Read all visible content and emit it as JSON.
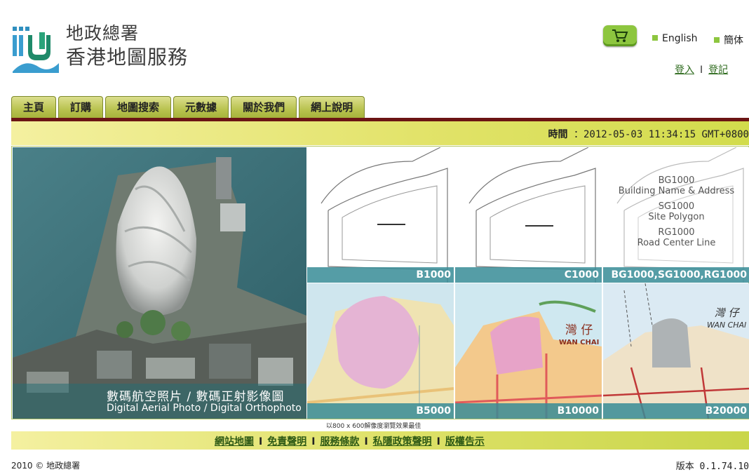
{
  "header": {
    "org_line1": "地政總署",
    "org_line2": "香港地圖服務",
    "lang_english": "English",
    "lang_simplified": "簡体",
    "login": "登入",
    "auth_separator": "I",
    "register": "登記"
  },
  "nav": {
    "tabs": [
      "主頁",
      "訂購",
      "地圖搜索",
      "元數據",
      "關於我們",
      "網上說明"
    ]
  },
  "timebar": {
    "label": "時間",
    "value": "：2012-05-03 11:34:15 GMT+0800"
  },
  "gallery": {
    "main": {
      "caption_zh": "數碼航空照片 / 數碼正射影像圖",
      "caption_en": "Digital Aerial Photo / Digital Orthophoto"
    },
    "tiles": [
      {
        "caption": "B1000"
      },
      {
        "caption": "C1000"
      },
      {
        "caption": "BG1000,SG1000,RG1000",
        "labels": [
          "BG1000",
          "Building Name & Address",
          "SG1000",
          "Site Polygon",
          "RG1000",
          "Road Center Line"
        ]
      },
      {
        "caption": "B5000"
      },
      {
        "caption": "B10000",
        "labels": [
          "灣 仔",
          "WAN CHAI"
        ]
      },
      {
        "caption": "B20000",
        "labels": [
          "灣 仔",
          "WAN CHAI"
        ]
      }
    ],
    "note": "以800 x 600解像度瀏覽效果最佳"
  },
  "footer": {
    "links": [
      "網站地圖",
      "免責聲明",
      "服務條款",
      "私隱政策聲明",
      "版權告示"
    ],
    "separator": "I",
    "copyright": "2010 © 地政總署",
    "version": "版本 0.1.74.10"
  },
  "colors": {
    "accent_green": "#8dc63f",
    "nav_dark": "#6b1414",
    "caption_teal": "#378c96"
  }
}
